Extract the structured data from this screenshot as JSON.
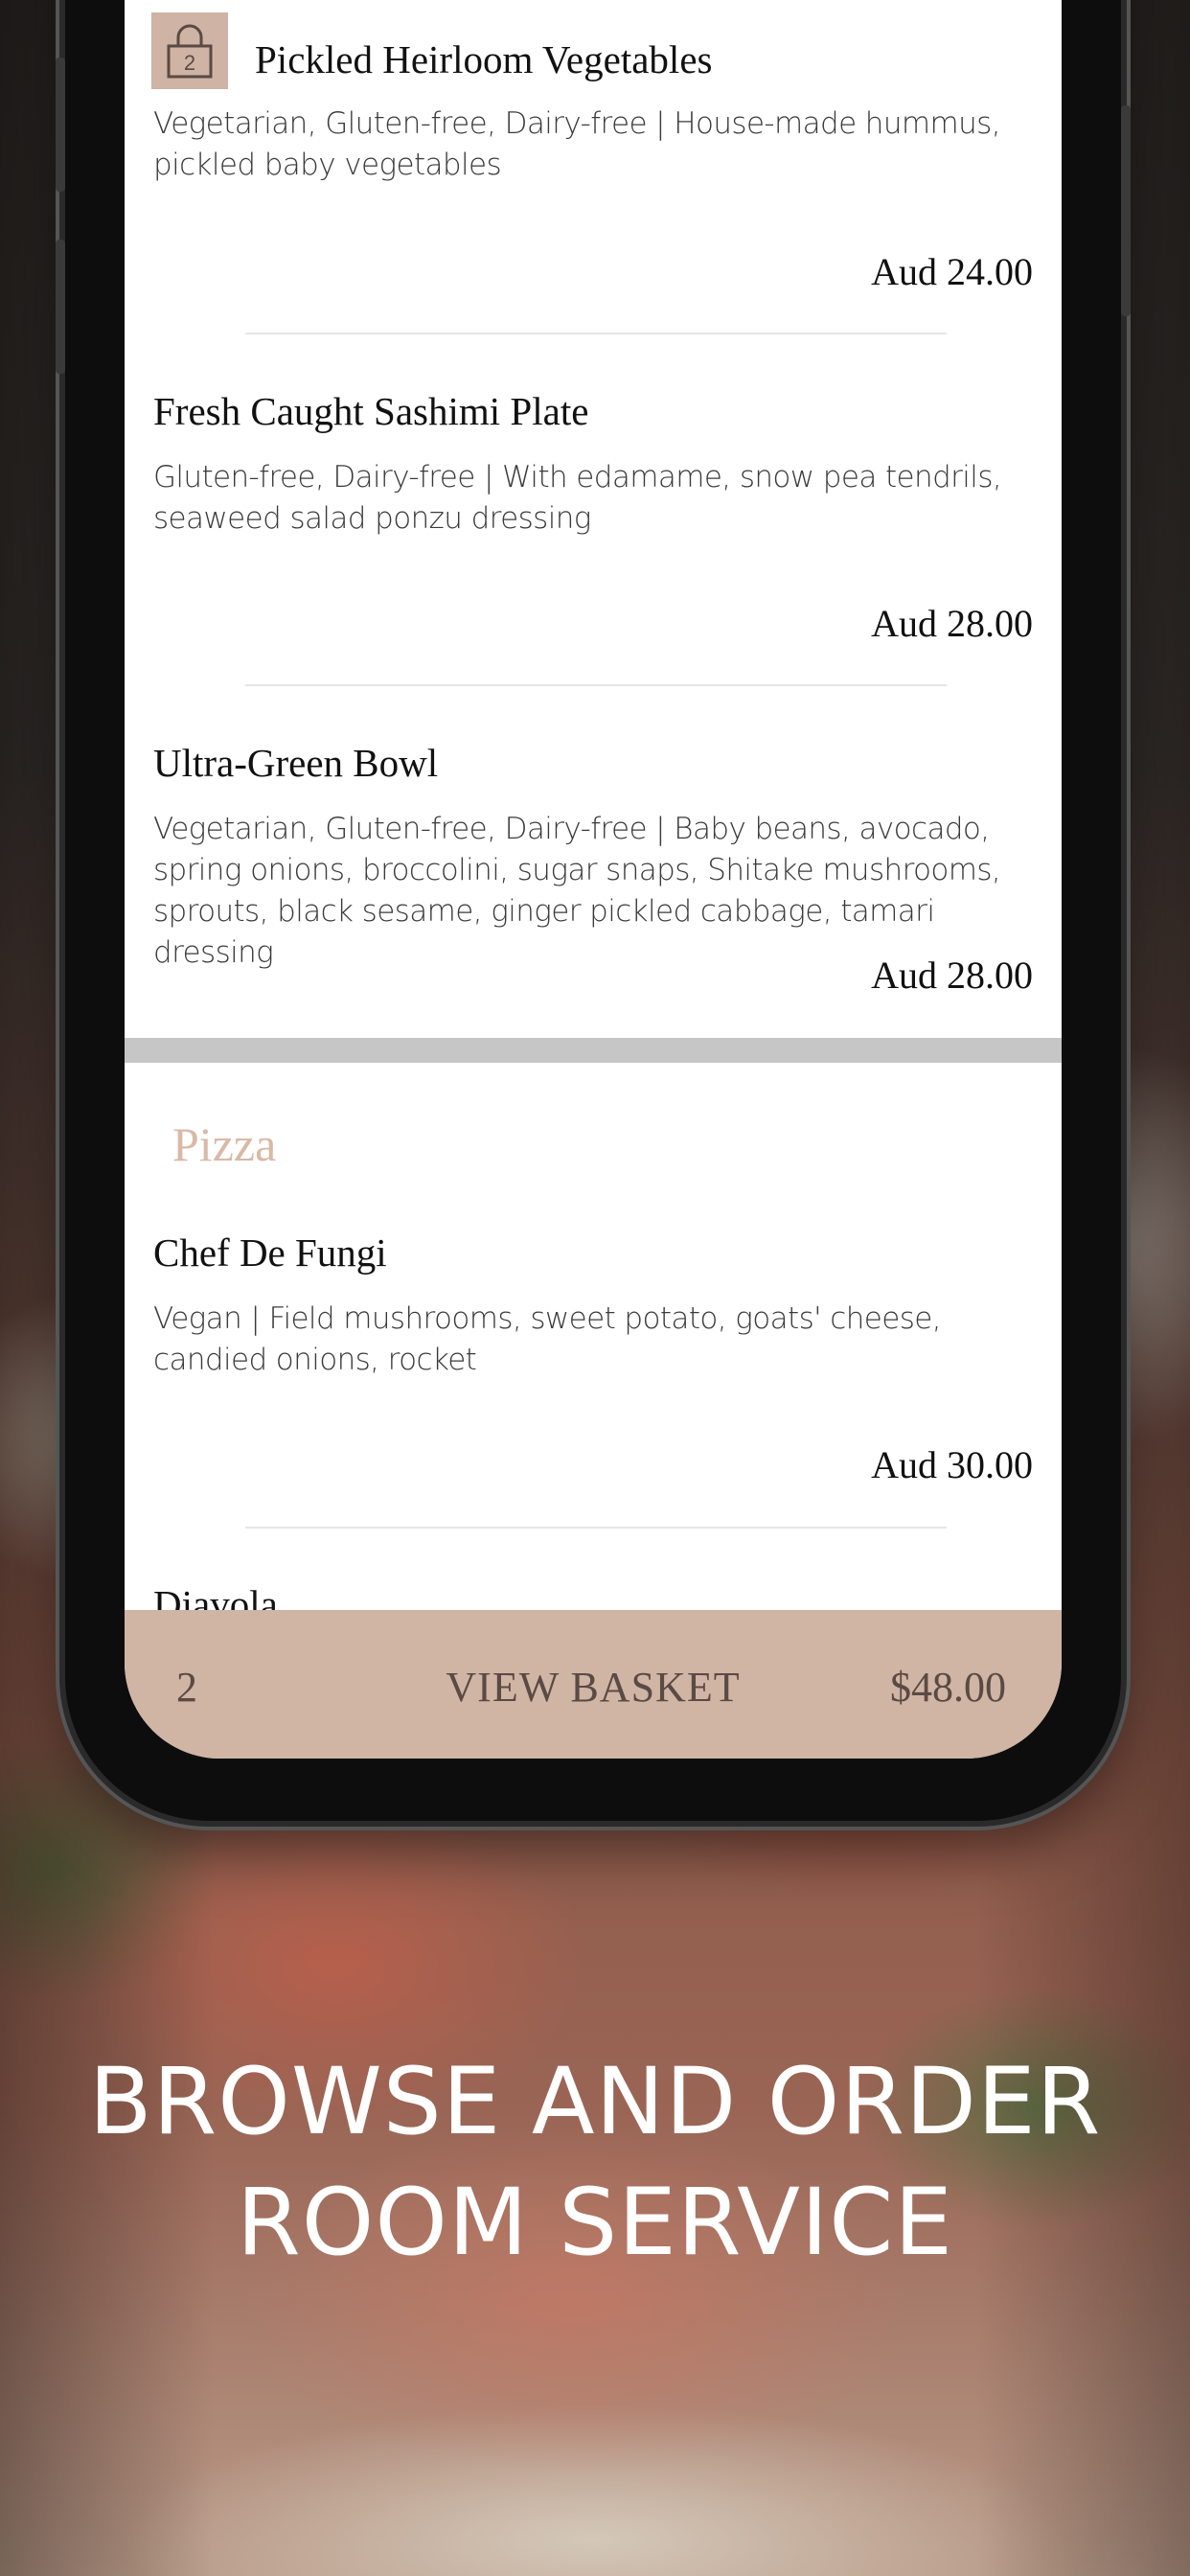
{
  "items": [
    {
      "title": "Pickled Heirloom Vegetables",
      "desc": "Vegetarian, Gluten-free, Dairy-free | House-made hummus, pickled baby vegetables",
      "price": "Aud 24.00",
      "badge_count": "2"
    },
    {
      "title": "Fresh Caught Sashimi Plate",
      "desc": "Gluten-free, Dairy-free | With edamame, snow pea tendrils, seaweed salad ponzu dressing",
      "price": "Aud 28.00"
    },
    {
      "title": "Ultra-Green Bowl",
      "desc": "Vegetarian, Gluten-free, Dairy-free | Baby beans, avocado, spring onions, broccolini, sugar snaps, Shitake mushrooms, sprouts, black sesame, ginger pickled cabbage, tamari dressing",
      "price": "Aud 28.00"
    }
  ],
  "pizza_section": {
    "title": "Pizza",
    "items": [
      {
        "title": "Chef De Fungi",
        "desc": "Vegan | Field mushrooms, sweet potato, goats' cheese, candied onions, rocket",
        "price": "Aud 30.00"
      },
      {
        "title": "Diavola"
      }
    ]
  },
  "basket": {
    "count": "2",
    "label": "VIEW BASKET",
    "total": "$48.00"
  },
  "headline": {
    "line1": "BROWSE AND ORDER",
    "line2": "ROOM SERVICE"
  },
  "colors": {
    "accent": "#d0b4a4",
    "section_title": "#d9b9a6",
    "section_break": "#c6c6c6"
  }
}
